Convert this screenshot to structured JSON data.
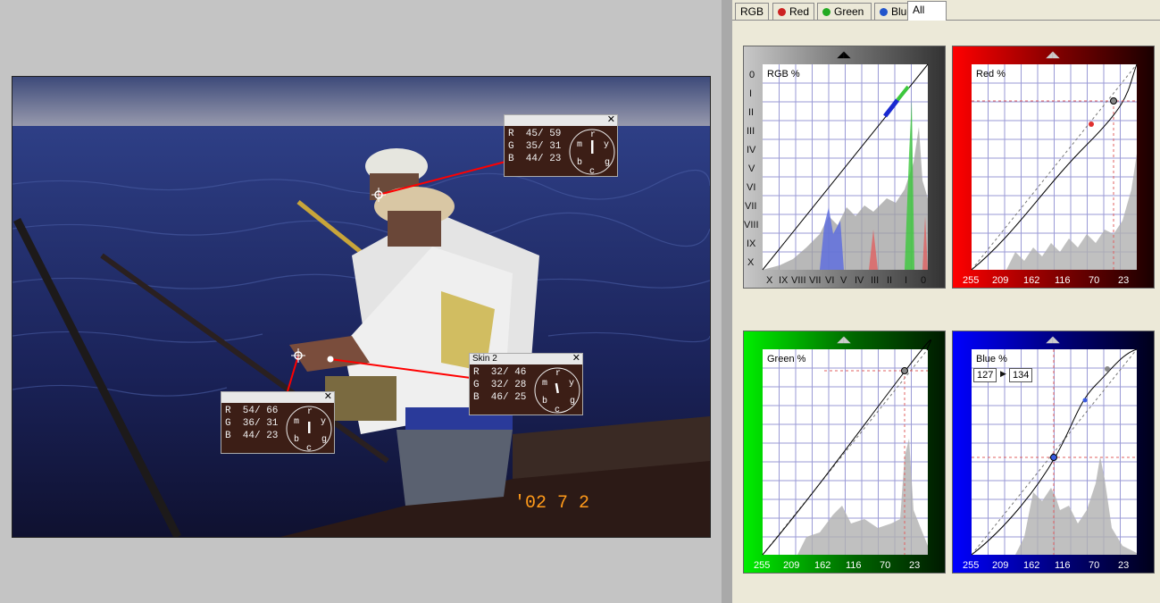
{
  "tabs": [
    {
      "label": "RGB",
      "dot": ""
    },
    {
      "label": "Red",
      "dot": "#cc2222"
    },
    {
      "label": "Green",
      "dot": "#22aa22"
    },
    {
      "label": "Blue",
      "dot": "#2255cc"
    },
    {
      "label": "All",
      "dot": ""
    }
  ],
  "active_tab": "All",
  "photo": {
    "date_stamp": "'02  7  2"
  },
  "probes": [
    {
      "title": "",
      "r": "R  45/ 59",
      "g": "G  35/ 31",
      "b": "B  44/ 23",
      "close": "✕"
    },
    {
      "title": "Skin 2",
      "r": "R  32/ 46",
      "g": "G  32/ 28",
      "b": "B  46/ 25",
      "close": "✕"
    },
    {
      "title": "",
      "r": "R  54/ 66",
      "g": "G  36/ 31",
      "b": "B  44/ 23",
      "close": "✕"
    }
  ],
  "dial_letters": {
    "m": "m",
    "r": "r",
    "y": "y",
    "b": "b",
    "c": "c",
    "g": "g"
  },
  "curves": {
    "rgb": {
      "label": "RGB %",
      "zones_left": [
        "0",
        "I",
        "II",
        "III",
        "IV",
        "V",
        "VI",
        "VII",
        "VIII",
        "IX",
        "X"
      ],
      "zones_bottom": [
        "X",
        "IX",
        "VIII",
        "VII",
        "VI",
        "V",
        "IV",
        "III",
        "II",
        "I",
        "0"
      ]
    },
    "red": {
      "label": "Red %",
      "axis": [
        "255",
        "209",
        "162",
        "116",
        "70",
        "23"
      ]
    },
    "green": {
      "label": "Green %",
      "axis": [
        "255",
        "209",
        "162",
        "116",
        "70",
        "23"
      ]
    },
    "blue": {
      "label": "Blue %",
      "axis": [
        "255",
        "209",
        "162",
        "116",
        "70",
        "23"
      ],
      "in_value": "127",
      "out_value": "134"
    }
  },
  "colors": {
    "red_gradient": "#cc0000",
    "green_gradient": "#00bb00",
    "blue_gradient": "#0000cc",
    "probe_bg": "#3c1e16",
    "probe_line": "#ff0000"
  }
}
